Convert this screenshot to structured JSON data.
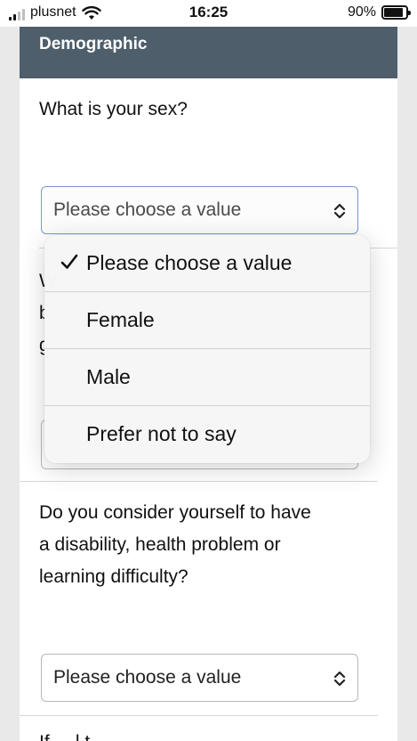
{
  "status_bar": {
    "carrier": "plusnet",
    "time": "16:25",
    "battery_percent": "90%",
    "battery_level": 0.9,
    "signal_bars_active": 2,
    "signal_bars_total": 4,
    "icons": [
      "signal-icon",
      "wifi-icon",
      "battery-icon"
    ]
  },
  "form": {
    "section_title": "Demographic",
    "questions": [
      {
        "label": "What is your sex?",
        "select_value": "Please choose a value"
      },
      {
        "label": "W\nb\ng",
        "select_value": ""
      },
      {
        "label": "Do you consider yourself to have\na disability, health problem or\nlearning difficulty?",
        "select_value": "Please choose a value"
      },
      {
        "label": "If ... l t"
      }
    ]
  },
  "dropdown": {
    "options": [
      {
        "label": "Please choose a value",
        "selected": true
      },
      {
        "label": "Female",
        "selected": false
      },
      {
        "label": "Male",
        "selected": false
      },
      {
        "label": "Prefer not to say",
        "selected": false
      }
    ]
  },
  "colors": {
    "header_bg": "#4e5e6b",
    "focus_border": "#7c97c8",
    "page_bg": "#e9e9ea"
  }
}
